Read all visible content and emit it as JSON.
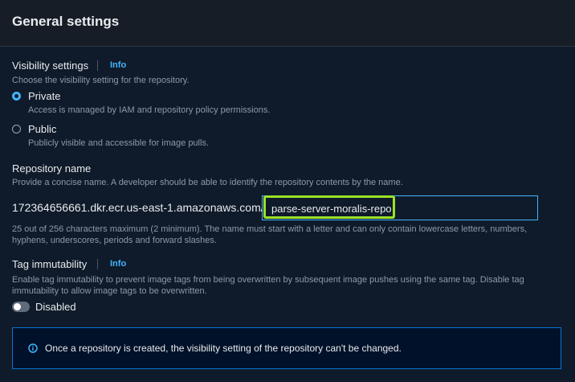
{
  "header": {
    "title": "General settings"
  },
  "visibility": {
    "label": "Visibility settings",
    "info": "Info",
    "description": "Choose the visibility setting for the repository.",
    "options": [
      {
        "label": "Private",
        "description": "Access is managed by IAM and repository policy permissions.",
        "selected": true
      },
      {
        "label": "Public",
        "description": "Publicly visible and accessible for image pulls.",
        "selected": false
      }
    ]
  },
  "repository": {
    "label": "Repository name",
    "description": "Provide a concise name. A developer should be able to identify the repository contents by the name.",
    "prefix": "172364656661.dkr.ecr.us-east-1.amazonaws.com/",
    "value": "parse-server-moralis-repo",
    "hint_line1": "25 out of 256 characters maximum (2 minimum). The name must start with a letter and can only contain lowercase letters, numbers,",
    "hint_line2": "hyphens, underscores, periods and forward slashes."
  },
  "tag_immutability": {
    "label": "Tag immutability",
    "info": "Info",
    "description_line1": "Enable tag immutability to prevent image tags from being overwritten by subsequent image pushes using the same tag. Disable tag",
    "description_line2": "immutability to allow image tags to be overwritten.",
    "toggle_label": "Disabled",
    "enabled": false
  },
  "alert": {
    "icon": "info-circle-icon",
    "text": "Once a repository is created, the visibility setting of the repository can't be changed."
  },
  "colors": {
    "accent": "#42b4ff",
    "highlight": "#9be227",
    "background": "#0f1b2a"
  }
}
